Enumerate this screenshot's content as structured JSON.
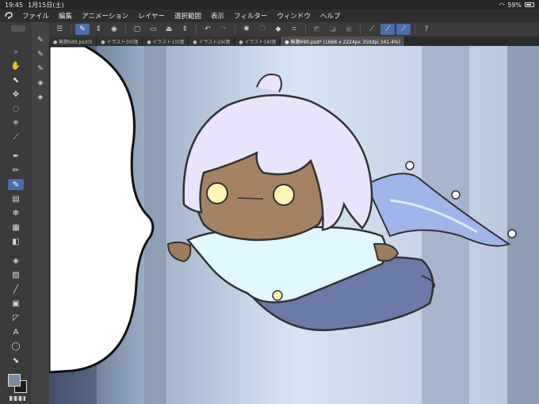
{
  "status": {
    "time": "19:45",
    "date": "1月15日(土)",
    "battery": "59%"
  },
  "menu": [
    "ファイル",
    "編集",
    "アニメーション",
    "レイヤー",
    "選択範囲",
    "表示",
    "フィルター",
    "ウィンドウ",
    "ヘルプ"
  ],
  "tabs": [
    {
      "label": "● 無題689.psd(S",
      "active": false
    },
    {
      "label": "● イラスト30(復",
      "active": false
    },
    {
      "label": "● イラスト10(復",
      "active": false
    },
    {
      "label": "● イラスト29(復",
      "active": false
    },
    {
      "label": "● イラスト18(復",
      "active": false
    },
    {
      "label": "● 無題690.psd* (1668 x 2224px 350dpi 341.4%)",
      "active": true
    }
  ],
  "colors": {
    "accent": "#4a6fa8",
    "main_color": "#7a8aa0",
    "sub_color": "#1a1a1a"
  }
}
